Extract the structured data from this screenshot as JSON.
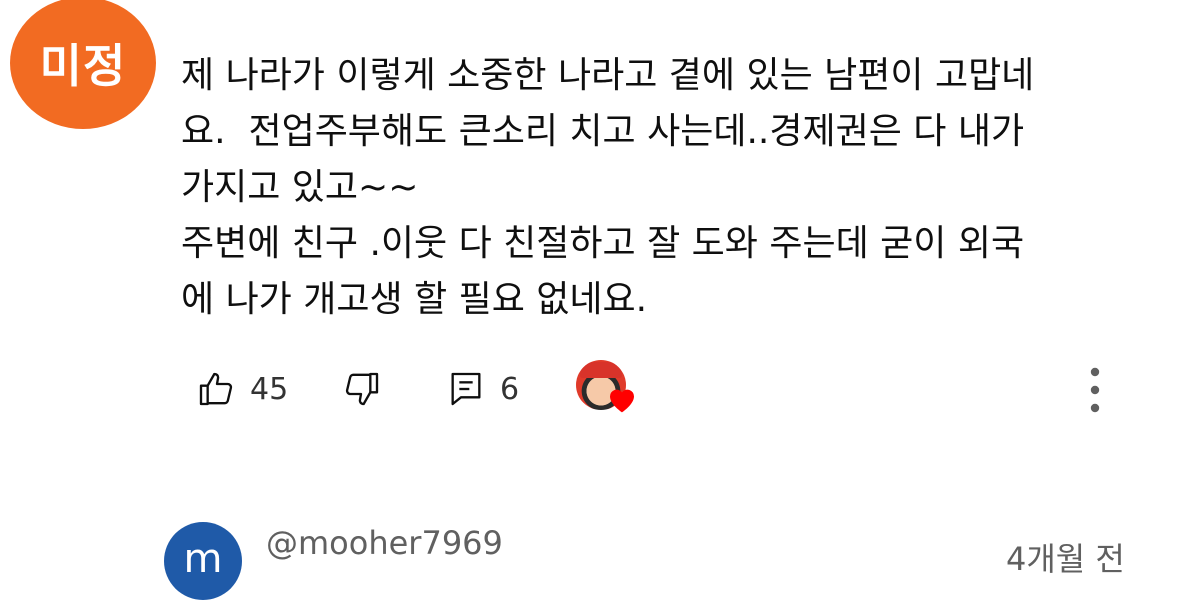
{
  "top_fragment": "",
  "comment": {
    "avatar_text": "미정",
    "lines": [
      "제 나라가 이렇게 소중한 나라고 곁에 있는 남편이 고맙네",
      "요.  전업주부해도 큰소리 치고 사는데..경제권은 다 내가",
      "가지고 있고~~",
      "주변에 친구 .이웃 다 친절하고 잘 도와 주는데 굳이 외국",
      "에 나가 개고생 할 필요 없네요."
    ],
    "like_icon": "thumbs-up-icon",
    "like_count": "45",
    "dislike_icon": "thumbs-down-icon",
    "reply_icon": "reply-icon",
    "reply_count": "6",
    "creator_heart_icon": "heart-icon",
    "more_icon": "more-vertical-icon",
    "accent_color": "#f26b22",
    "heart_color": "#ff0000"
  },
  "reply": {
    "avatar_text": "m",
    "avatar_color": "#1f5aa8",
    "username": "@mooher7969",
    "time": "4개월 전",
    "partial_text": ""
  }
}
